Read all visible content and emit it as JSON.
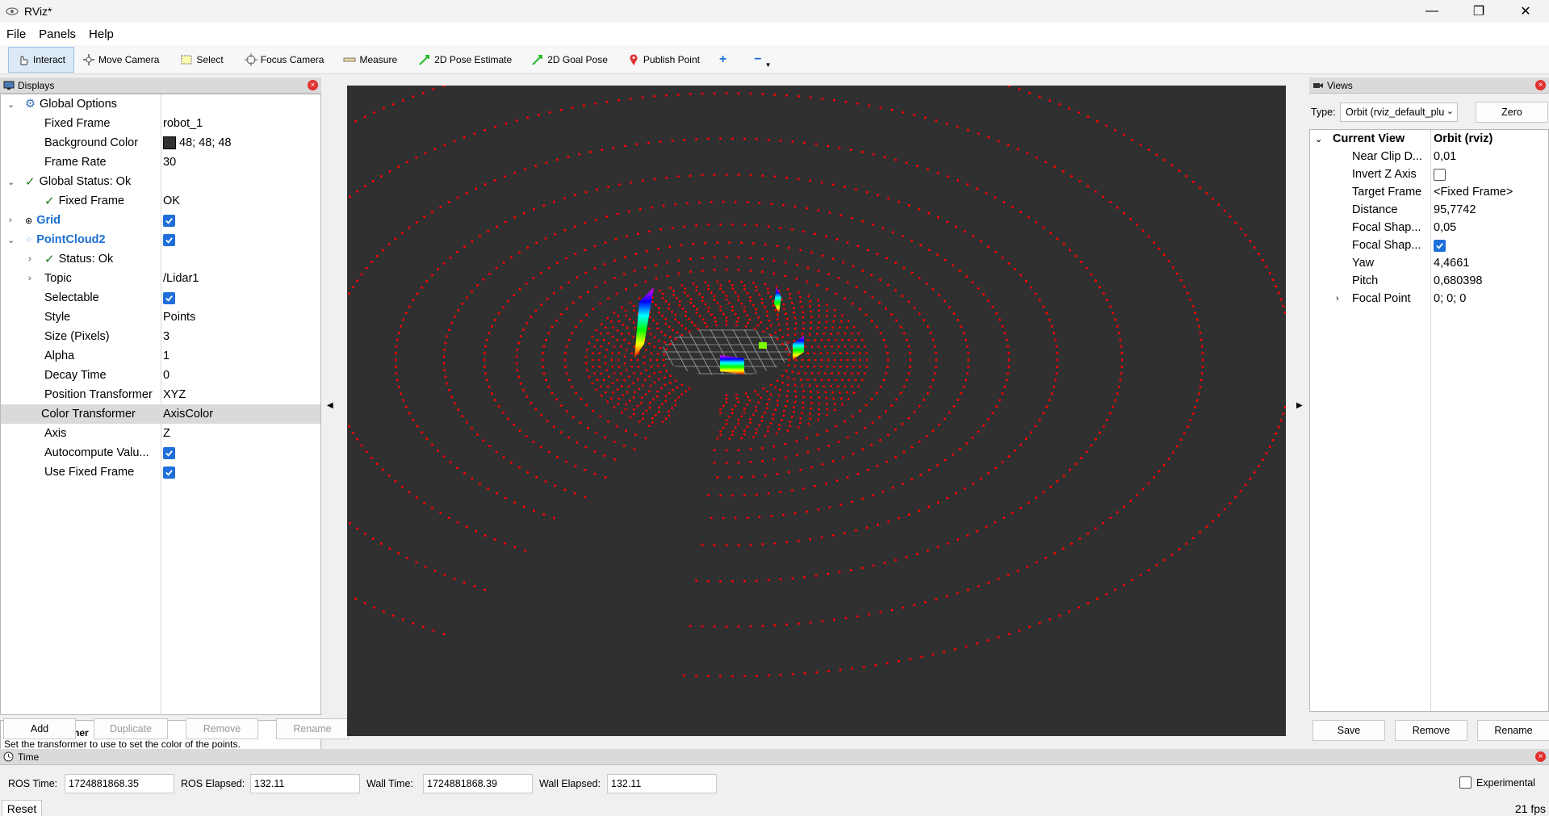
{
  "window": {
    "title": "RViz*",
    "minimize": "—",
    "maximize": "❐",
    "close": "✕"
  },
  "menu": [
    "File",
    "Panels",
    "Help"
  ],
  "toolbar": {
    "interact": "Interact",
    "move_camera": "Move Camera",
    "select": "Select",
    "focus_camera": "Focus Camera",
    "measure": "Measure",
    "pose_estimate": "2D Pose Estimate",
    "goal_pose": "2D Goal Pose",
    "publish_point": "Publish Point",
    "add_tool": "+",
    "remove_tool": "−"
  },
  "displays": {
    "header": "Displays",
    "global_options": "Global Options",
    "fixed_frame_label": "Fixed Frame",
    "fixed_frame_value": "robot_1",
    "bg_color_label": "Background Color",
    "bg_color_value": "48; 48; 48",
    "frame_rate_label": "Frame Rate",
    "frame_rate_value": "30",
    "global_status": "Global Status: Ok",
    "status_fixed_frame": "Fixed Frame",
    "status_fixed_frame_value": "OK",
    "grid": "Grid",
    "pointcloud": "PointCloud2",
    "pc_status": "Status: Ok",
    "topic_label": "Topic",
    "topic_value": "/Lidar1",
    "selectable_label": "Selectable",
    "style_label": "Style",
    "style_value": "Points",
    "size_label": "Size (Pixels)",
    "size_value": "3",
    "alpha_label": "Alpha",
    "alpha_value": "1",
    "decay_label": "Decay Time",
    "decay_value": "0",
    "pos_tf_label": "Position Transformer",
    "pos_tf_value": "XYZ",
    "color_tf_label": "Color Transformer",
    "color_tf_value": "AxisColor",
    "axis_label": "Axis",
    "axis_value": "Z",
    "autocompute_label": "Autocompute Valu...",
    "fixed_frame_use_label": "Use Fixed Frame",
    "desc_title": "Color Transformer",
    "desc_text": "Set the transformer to use to set the color of the points.",
    "btn_add": "Add",
    "btn_duplicate": "Duplicate",
    "btn_remove": "Remove",
    "btn_rename": "Rename"
  },
  "views": {
    "header": "Views",
    "type_label": "Type:",
    "type_value": "Orbit (rviz_default_plu",
    "zero": "Zero",
    "current_view": "Current View",
    "current_view_value": "Orbit (rviz)",
    "rows": [
      {
        "k": "Near Clip D...",
        "v": "0,01"
      },
      {
        "k": "Invert Z Axis",
        "v": ""
      },
      {
        "k": "Target Frame",
        "v": "<Fixed Frame>"
      },
      {
        "k": "Distance",
        "v": "95,7742"
      },
      {
        "k": "Focal Shap...",
        "v": "0,05"
      },
      {
        "k": "Focal Shap...",
        "v": ""
      },
      {
        "k": "Yaw",
        "v": "4,4661"
      },
      {
        "k": "Pitch",
        "v": "0,680398"
      },
      {
        "k": "Focal Point",
        "v": "0; 0; 0"
      }
    ],
    "btn_save": "Save",
    "btn_remove": "Remove",
    "btn_rename": "Rename"
  },
  "time": {
    "header": "Time",
    "ros_time_label": "ROS Time:",
    "ros_time": "1724881868.35",
    "ros_elapsed_label": "ROS Elapsed:",
    "ros_elapsed": "132.11",
    "wall_time_label": "Wall Time:",
    "wall_time": "1724881868.39",
    "wall_elapsed_label": "Wall Elapsed:",
    "wall_elapsed": "132.11",
    "experimental": "Experimental",
    "reset": "Reset",
    "fps": "21 fps"
  },
  "colors": {
    "viewport_bg": "#303030",
    "points": "#ff0000",
    "accent": "#1e6fd9"
  }
}
